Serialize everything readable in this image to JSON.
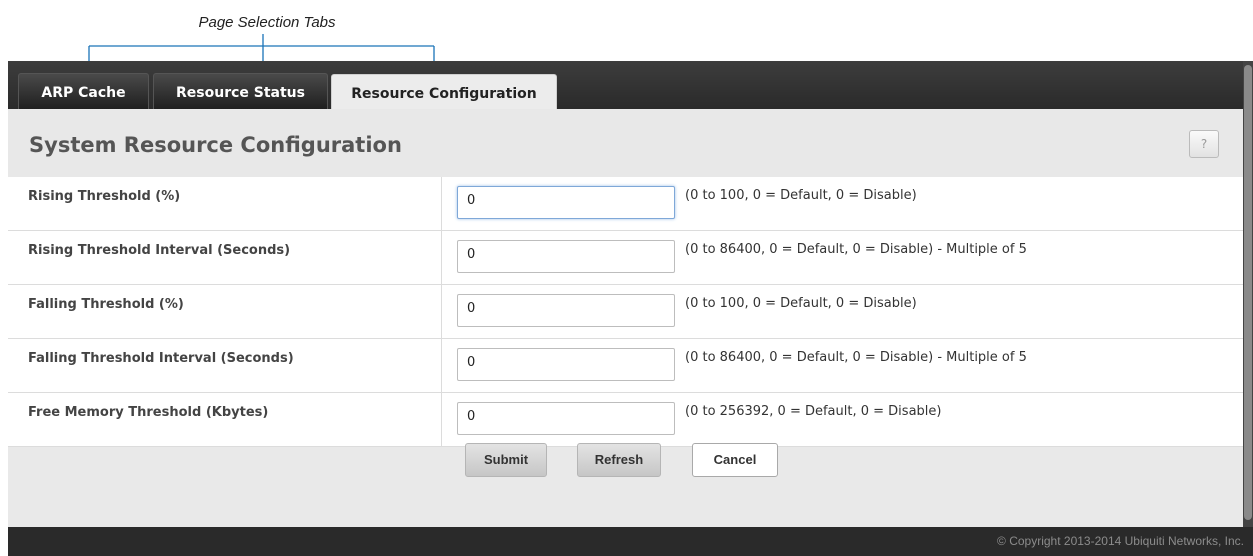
{
  "callout": {
    "label": "Page Selection Tabs",
    "line_color": "#1a73b8"
  },
  "tabs": [
    {
      "label": "ARP Cache",
      "active": false
    },
    {
      "label": "Resource Status",
      "active": false
    },
    {
      "label": "Resource Configuration",
      "active": true
    }
  ],
  "page": {
    "title": "System Resource Configuration",
    "help_label": "?"
  },
  "fields": [
    {
      "label": "Rising Threshold  (%)",
      "value": "0",
      "hint": "(0 to 100, 0 = Default, 0 = Disable)",
      "focused": true
    },
    {
      "label": "Rising Threshold Interval  (Seconds)",
      "value": "0",
      "hint": "(0 to 86400, 0 = Default, 0 = Disable) - Multiple of 5",
      "focused": false
    },
    {
      "label": "Falling Threshold  (%)",
      "value": "0",
      "hint": "(0 to 100, 0 = Default, 0 = Disable)",
      "focused": false
    },
    {
      "label": "Falling Threshold Interval  (Seconds)",
      "value": "0",
      "hint": "(0 to 86400, 0 = Default, 0 = Disable) - Multiple of 5",
      "focused": false
    },
    {
      "label": "Free Memory Threshold  (Kbytes)",
      "value": "0",
      "hint": "(0 to 256392, 0 = Default, 0 = Disable)",
      "focused": false
    }
  ],
  "buttons": {
    "submit": "Submit",
    "refresh": "Refresh",
    "cancel": "Cancel"
  },
  "footer": {
    "copyright": "© Copyright 2013-2014 Ubiquiti Networks, Inc."
  },
  "icons": {
    "help": "question-mark-icon"
  }
}
